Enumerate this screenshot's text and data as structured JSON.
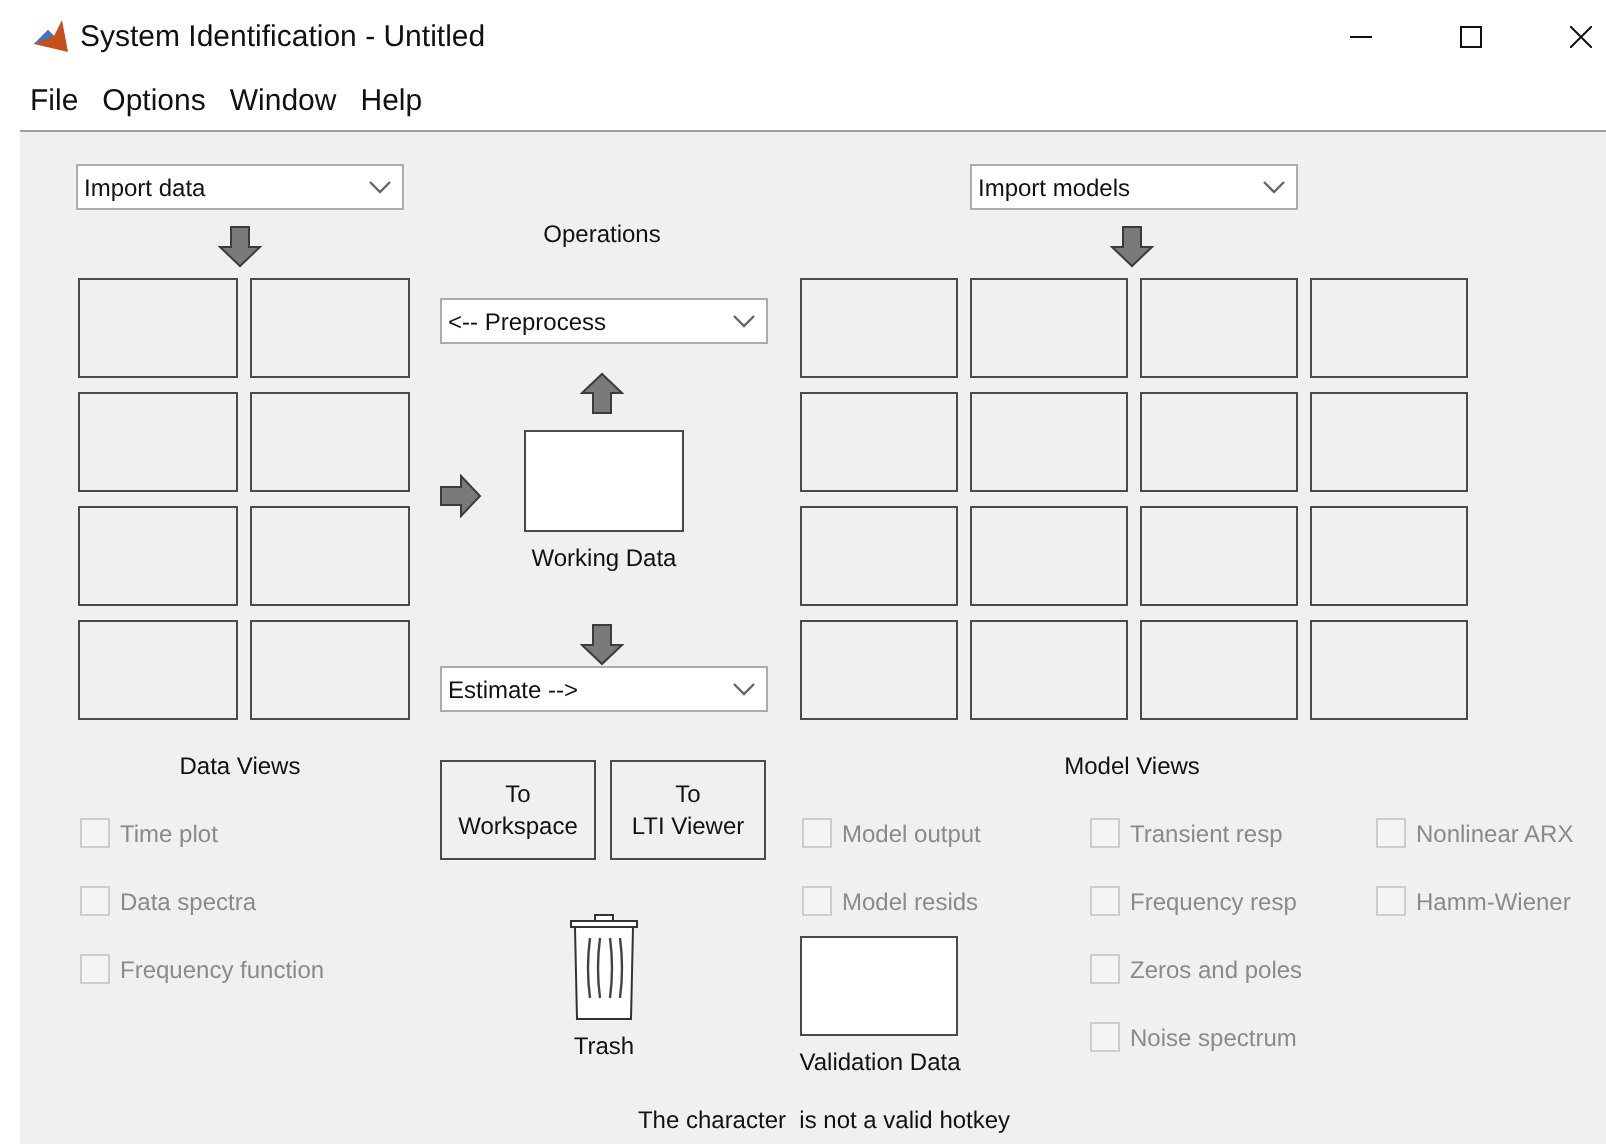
{
  "window": {
    "title": "System Identification - Untitled"
  },
  "menu": [
    "File",
    "Options",
    "Window",
    "Help"
  ],
  "data_import": {
    "value": "Import data"
  },
  "operations": {
    "title": "Operations",
    "preprocess": "<-- Preprocess",
    "working_data": "Working Data",
    "estimate": "Estimate -->"
  },
  "model_import": {
    "value": "Import models"
  },
  "data_views": {
    "title": "Data Views",
    "options": [
      {
        "label": "Time plot",
        "checked": false,
        "disabled": true
      },
      {
        "label": "Data spectra",
        "checked": false,
        "disabled": true
      },
      {
        "label": "Frequency function",
        "checked": false,
        "disabled": true
      }
    ]
  },
  "buttons": [
    {
      "lines": [
        "To",
        "Workspace"
      ]
    },
    {
      "lines": [
        "To",
        "LTI Viewer"
      ]
    }
  ],
  "trash": {
    "label": "Trash"
  },
  "validation": {
    "label": "Validation Data"
  },
  "model_views": {
    "title": "Model Views",
    "columns": [
      [
        {
          "label": "Model output",
          "checked": false,
          "disabled": true
        },
        {
          "label": "Model resids",
          "checked": false,
          "disabled": true
        }
      ],
      [
        {
          "label": "Transient resp",
          "checked": false,
          "disabled": true
        },
        {
          "label": "Frequency resp",
          "checked": false,
          "disabled": true
        },
        {
          "label": "Zeros and poles",
          "checked": false,
          "disabled": true
        },
        {
          "label": "Noise spectrum",
          "checked": false,
          "disabled": true
        }
      ],
      [
        {
          "label": "Nonlinear ARX",
          "checked": false,
          "disabled": true
        },
        {
          "label": "Hamm-Wiener",
          "checked": false,
          "disabled": true
        }
      ]
    ]
  },
  "status": "The character  is not a valid hotkey"
}
